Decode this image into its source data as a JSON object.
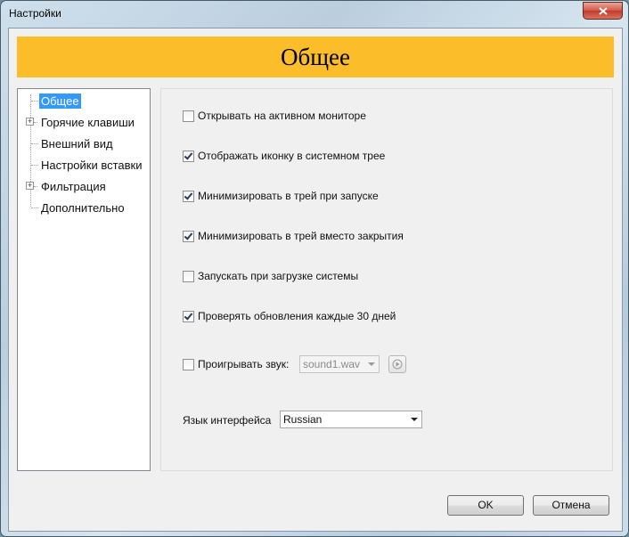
{
  "window": {
    "title": "Настройки"
  },
  "banner": {
    "title": "Общее"
  },
  "tree": {
    "items": [
      {
        "label": "Общее",
        "selected": true,
        "expandable": false
      },
      {
        "label": "Горячие клавиши",
        "selected": false,
        "expandable": true
      },
      {
        "label": "Внешний вид",
        "selected": false,
        "expandable": false
      },
      {
        "label": "Настройки вставки",
        "selected": false,
        "expandable": false
      },
      {
        "label": "Фильтрация",
        "selected": false,
        "expandable": true
      },
      {
        "label": "Дополнительно",
        "selected": false,
        "expandable": false
      }
    ]
  },
  "options": [
    {
      "label": "Открывать на активном мониторе",
      "checked": false
    },
    {
      "label": "Отображать иконку в системном трее",
      "checked": true
    },
    {
      "label": "Минимизировать в трей при запуске",
      "checked": true
    },
    {
      "label": "Минимизировать в трей вместо закрытия",
      "checked": true
    },
    {
      "label": "Запускать при загрузке системы",
      "checked": false
    },
    {
      "label": "Проверять обновления каждые 30 дней",
      "checked": true
    }
  ],
  "sound": {
    "label": "Проигрывать звук:",
    "checked": false,
    "file": "sound1.wav"
  },
  "language": {
    "label": "Язык интерфейса",
    "value": "Russian"
  },
  "buttons": {
    "ok": "OK",
    "cancel": "Отмена"
  },
  "icons": {
    "close": "close-icon",
    "play": "play-sound-icon",
    "expander": "plus"
  }
}
